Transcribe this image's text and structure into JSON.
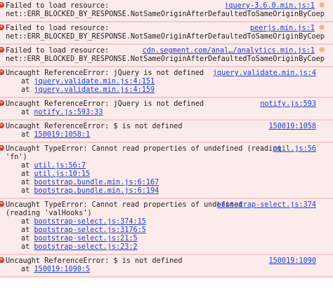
{
  "messages": [
    {
      "text": "Failed to load resource:",
      "source": "jquery-3.6.0.min.js:1",
      "detail": "net::ERR_BLOCKED_BY_RESPONSE.NotSameOriginAfterDefaultedToSameOriginByCoep",
      "icon": "globe-icon"
    },
    {
      "text": "Failed to load resource:",
      "source": "peerjs.min.js:1",
      "detail": "net::ERR_BLOCKED_BY_RESPONSE.NotSameOriginAfterDefaultedToSameOriginByCoep",
      "icon": "globe-icon"
    },
    {
      "text": "Failed to load resource:",
      "source": "cdn.segment.com/anal…/analytics.min.js:1",
      "detail": "net::ERR_BLOCKED_BY_RESPONSE.NotSameOriginAfterDefaultedToSameOriginByCoep",
      "icon": "globe-icon"
    },
    {
      "text": "Uncaught ReferenceError: jQuery is not defined",
      "source": "jquery.validate.min.js:4",
      "frames": [
        "jquery.validate.min.js:4:151",
        "jquery.validate.min.js:4:159"
      ]
    },
    {
      "text": "Uncaught ReferenceError: jQuery is not defined",
      "source": "notify.js:593",
      "frames": [
        "notify.js:593:33"
      ]
    },
    {
      "text": "Uncaught ReferenceError: $ is not defined",
      "source": "150019:1058",
      "frames": [
        "150019:1058:1"
      ]
    },
    {
      "text": "Uncaught TypeError: Cannot read properties of undefined (reading",
      "text2": "'fn')",
      "source": "util.js:56",
      "frames": [
        "util.js:56:7",
        "util.js:10:15",
        "bootstrap.bundle.min.js:6:167",
        "bootstrap.bundle.min.js:6:194"
      ]
    },
    {
      "text": "Uncaught TypeError: Cannot read properties of undefined",
      "text2": "(reading 'valHooks')",
      "source": "bootstrap-select.js:374",
      "frames": [
        "bootstrap-select.js:374:15",
        "bootstrap-select.js:3176:5",
        "bootstrap-select.js:21:5",
        "bootstrap-select.js:23:2"
      ]
    },
    {
      "text": "Uncaught ReferenceError: $ is not defined",
      "source": "150019:1090",
      "frames": [
        "150019:1090:5"
      ]
    }
  ],
  "at_label": "at",
  "colors": {
    "error_bg": "#fcebeb",
    "link": "#1a3fd3",
    "error_icon": "#d93025"
  }
}
